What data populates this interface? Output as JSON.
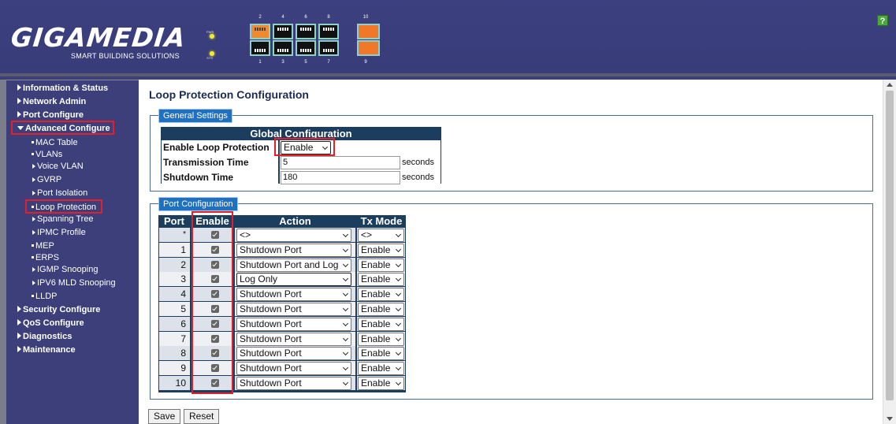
{
  "header": {
    "logo": "GIGAMEDIA",
    "logo_sub": "SMART BUILDING SOLUTIONS",
    "led_pwr": "PWR",
    "led_sys": "SYS",
    "ports_top": [
      "2",
      "4",
      "6",
      "8"
    ],
    "ports_bottom": [
      "1",
      "3",
      "5",
      "7"
    ],
    "sfp_top": "10",
    "sfp_bottom": "9",
    "help": "?"
  },
  "sidebar": {
    "top_items": [
      "Information & Status",
      "Network Admin",
      "Port Configure",
      "Advanced Configure"
    ],
    "sub_items": [
      {
        "label": "MAC Table",
        "type": "leaf"
      },
      {
        "label": "VLANs",
        "type": "leaf"
      },
      {
        "label": "Voice VLAN",
        "type": "branch"
      },
      {
        "label": "GVRP",
        "type": "branch"
      },
      {
        "label": "Port Isolation",
        "type": "branch"
      },
      {
        "label": "Loop Protection",
        "type": "leaf"
      },
      {
        "label": "Spanning Tree",
        "type": "branch"
      },
      {
        "label": "IPMC Profile",
        "type": "branch"
      },
      {
        "label": "MEP",
        "type": "leaf"
      },
      {
        "label": "ERPS",
        "type": "leaf"
      },
      {
        "label": "IGMP Snooping",
        "type": "branch"
      },
      {
        "label": "IPV6 MLD Snooping",
        "type": "branch"
      },
      {
        "label": "LLDP",
        "type": "leaf"
      }
    ],
    "bottom_items": [
      "Security Configure",
      "QoS Configure",
      "Diagnostics",
      "Maintenance"
    ]
  },
  "main": {
    "title": "Loop Protection Configuration",
    "general_legend": "General Settings",
    "global": {
      "title": "Global Configuration",
      "enable_label": "Enable Loop Protection",
      "enable_value": "Enable",
      "trans_label": "Transmission Time",
      "trans_value": "5",
      "shut_label": "Shutdown Time",
      "shut_value": "180",
      "unit": "seconds"
    },
    "port_legend": "Port Configuration",
    "port_headers": [
      "Port",
      "Enable",
      "Action",
      "Tx Mode"
    ],
    "rows": [
      {
        "port": "*",
        "action": "<>",
        "tx": "<>"
      },
      {
        "port": "1",
        "action": "Shutdown Port",
        "tx": "Enable"
      },
      {
        "port": "2",
        "action": "Shutdown Port and Log",
        "tx": "Enable"
      },
      {
        "port": "3",
        "action": "Log Only",
        "tx": "Enable"
      },
      {
        "port": "4",
        "action": "Shutdown Port",
        "tx": "Enable"
      },
      {
        "port": "5",
        "action": "Shutdown Port",
        "tx": "Enable"
      },
      {
        "port": "6",
        "action": "Shutdown Port",
        "tx": "Enable"
      },
      {
        "port": "7",
        "action": "Shutdown Port",
        "tx": "Enable"
      },
      {
        "port": "8",
        "action": "Shutdown Port",
        "tx": "Enable"
      },
      {
        "port": "9",
        "action": "Shutdown Port",
        "tx": "Enable"
      },
      {
        "port": "10",
        "action": "Shutdown Port",
        "tx": "Enable"
      }
    ],
    "save": "Save",
    "reset": "Reset"
  },
  "colors": {
    "header_bg": "#3c4080",
    "table_header": "#1c3e5e",
    "legend": "#2070c0",
    "highlight": "#e0202a",
    "port_active": "#f08a30"
  }
}
